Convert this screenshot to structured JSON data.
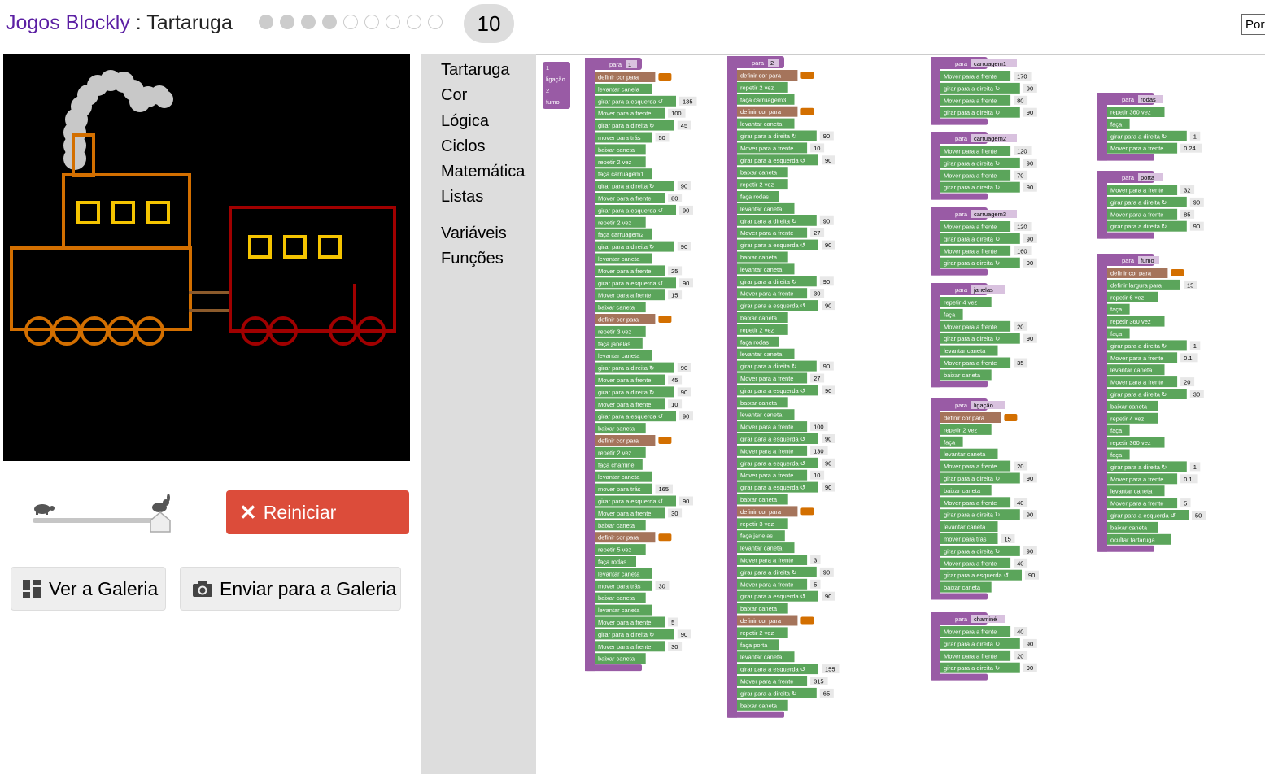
{
  "header": {
    "app_name": "Jogos Blockly",
    "separator": " : ",
    "game_name": "Tartaruga",
    "levels_total": 10,
    "levels_completed": 4,
    "current_level": "10",
    "language": "Português"
  },
  "controls": {
    "speed_fraction": 0.95,
    "reset_label": "Reiniciar",
    "gallery_label": "Ver a Galeria",
    "submit_label": "Enviar para a Galeria"
  },
  "toolbox": {
    "categories": [
      "Tartaruga",
      "Cor",
      "Lógica",
      "Ciclos",
      "Matemática",
      "Listas"
    ],
    "extra_categories": [
      "Variáveis",
      "Funções"
    ]
  },
  "colors": {
    "brand": "#5b1fa3",
    "reset_button": "#dc4c3a",
    "block_procedure": "#995ba5",
    "block_turtle": "#5ba55b",
    "block_loop": "#5ba55b",
    "block_color": "#a5745b",
    "orange": "#d36f00",
    "red": "#a00000",
    "yellow": "#f5c400",
    "brown": "#8b5a2b",
    "smoke": "#c8c8c8"
  },
  "workspace": {
    "param_block": [
      "1",
      "ligação",
      "2",
      "fumo"
    ],
    "procedures": [
      {
        "name": "1",
        "lines": [
          "definir cor para",
          "levantar canela",
          "girar para a esquerda ↺ 135",
          "Mover para a frente 100",
          "girar para a direita ↻ 45",
          "mover para trás 50",
          "baixar caneta",
          "repetir 2 vez",
          "faça carruagem1",
          "girar para a direita ↻ 90",
          "Mover para a frente 80",
          "girar para a esquerda ↺ 90",
          "repetir 2 vez",
          "faça carruagem2",
          "girar para a direita ↻ 90",
          "levantar caneta",
          "Mover para a frente 25",
          "girar para a esquerda ↺ 90",
          "Mover para a frente 15",
          "baixar caneta",
          "definir cor para",
          "repetir 3 vez",
          "faça janelas",
          "levantar caneta",
          "girar para a direita ↻ 90",
          "Mover para a frente 45",
          "girar para a direita ↻ 90",
          "Mover para a frente 10",
          "girar para a esquerda ↺ 90",
          "baixar caneta",
          "definir cor para",
          "repetir 2 vez",
          "faça chaminé",
          "levantar caneta",
          "mover para trás 165",
          "girar para a esquerda ↺ 90",
          "Mover para a frente 30",
          "baixar caneta",
          "definir cor para",
          "repetir 5 vez",
          "faça rodas",
          "levantar caneta",
          "mover para trás 30",
          "baixar caneta",
          "levantar caneta",
          "Mover para a frente 5",
          "girar para a direita ↻ 90",
          "Mover para a frente 30",
          "baixar caneta"
        ]
      },
      {
        "name": "2",
        "lines": [
          "definir cor para",
          "repetir 2 vez",
          "faça carruagem3",
          "definir cor para",
          "levantar caneta",
          "girar para a direita ↻ 90",
          "Mover para a frente 10",
          "girar para a esquerda ↺ 90",
          "baixar caneta",
          "repetir 2 vez",
          "faça rodas",
          "levantar caneta",
          "girar para a direita ↻ 90",
          "Mover para a frente 27",
          "girar para a esquerda ↺ 90",
          "baixar caneta",
          "levantar caneta",
          "girar para a direita ↻ 90",
          "Mover para a frente 30",
          "girar para a esquerda ↺ 90",
          "baixar caneta",
          "repetir 2 vez",
          "faça rodas",
          "levantar caneta",
          "girar para a direita ↻ 90",
          "Mover para a frente 27",
          "girar para a esquerda ↺ 90",
          "baixar caneta",
          "levantar caneta",
          "Mover para a frente 100",
          "girar para a esquerda ↺ 90",
          "Mover para a frente 130",
          "girar para a esquerda ↺ 90",
          "Mover para a frente 10",
          "girar para a esquerda ↺ 90",
          "baixar caneta",
          "definir cor para",
          "repetir 3 vez",
          "faça janelas",
          "levantar caneta",
          "Mover para a frente 3",
          "girar para a direita ↻ 90",
          "Mover para a frente 5",
          "girar para a esquerda ↺ 90",
          "baixar caneta",
          "definir cor para",
          "repetir 2 vez",
          "faça porta",
          "levantar caneta",
          "girar para a esquerda ↺ 155",
          "Mover para a frente 315",
          "girar para a direita ↻ 65",
          "baixar caneta"
        ]
      },
      {
        "name": "carruagem1",
        "lines": [
          "Mover para a frente 170",
          "girar para a direita ↻ 90",
          "Mover para a frente 80",
          "girar para a direita ↻ 90"
        ]
      },
      {
        "name": "carruagem2",
        "lines": [
          "Mover para a frente 120",
          "girar para a direita ↻ 90",
          "Mover para a frente 70",
          "girar para a direita ↻ 90"
        ]
      },
      {
        "name": "carruagem3",
        "lines": [
          "Mover para a frente 120",
          "girar para a direita ↻ 90",
          "Mover para a frente 160",
          "girar para a direita ↻ 90"
        ]
      },
      {
        "name": "janelas",
        "lines": [
          "repetir 4 vez",
          "faça",
          "Mover para a frente 20",
          "girar para a direita ↻ 90",
          "levantar caneta",
          "Mover para a frente 35",
          "baixar caneta"
        ]
      },
      {
        "name": "ligação",
        "lines": [
          "definir cor para",
          "repetir 2 vez",
          "faça",
          "levantar caneta",
          "Mover para a frente 20",
          "girar para a direita ↻ 90",
          "baixar caneta",
          "Mover para a frente 40",
          "girar para a direita ↻ 90",
          "levantar caneta",
          "mover para trás 15",
          "girar para a direita ↻ 90",
          "Mover para a frente 40",
          "girar para a esquerda ↺ 90",
          "baixar caneta"
        ]
      },
      {
        "name": "chaminé",
        "lines": [
          "Mover para a frente 40",
          "girar para a direita ↻ 90",
          "Mover para a frente 20",
          "girar para a direita ↻ 90"
        ]
      },
      {
        "name": "rodas",
        "lines": [
          "repetir 360 vez",
          "faça",
          "girar para a direita ↻ 1",
          "Mover para a frente 0.24"
        ]
      },
      {
        "name": "porta",
        "lines": [
          "Mover para a frente 32",
          "girar para a direita ↻ 90",
          "Mover para a frente 85",
          "girar para a direita ↻ 90"
        ]
      },
      {
        "name": "fumo",
        "lines": [
          "definir cor para",
          "definir largura para 15",
          "repetir 6 vez",
          "faça",
          "repetir 360 vez",
          "faça",
          "girar para a direita ↻ 1",
          "Mover para a frente 0.1",
          "levantar caneta",
          "Mover para a frente 20",
          "girar para a direita ↻ 30",
          "baixar caneta",
          "repetir 4 vez",
          "faça",
          "repetir 360 vez",
          "faça",
          "girar para a direita ↻ 1",
          "Mover para a frente 0.1",
          "levantar caneta",
          "Mover para a frente 5",
          "girar para a esquerda ↺ 50",
          "baixar caneta",
          "ocultar tartaruga"
        ]
      }
    ]
  }
}
